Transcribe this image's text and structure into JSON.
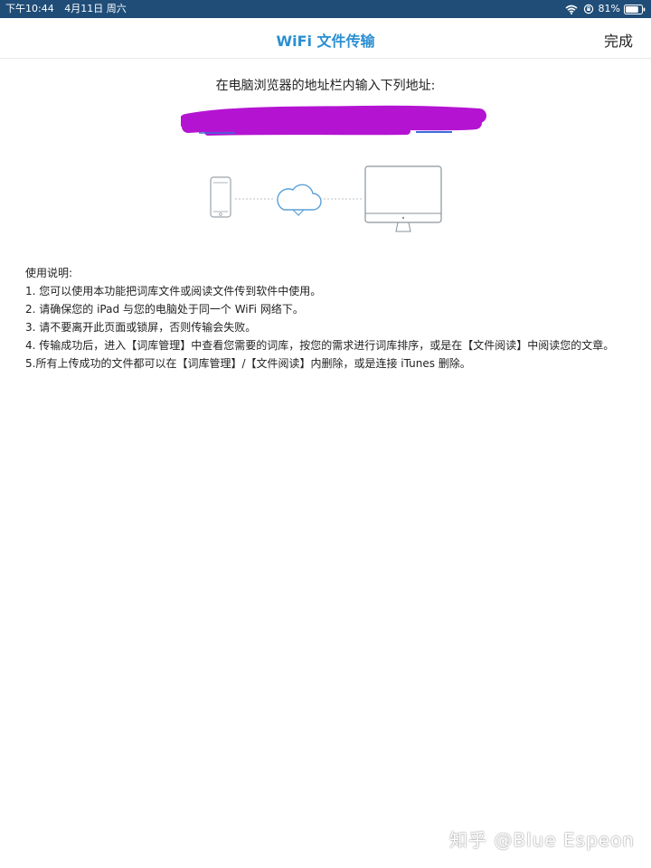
{
  "status_bar": {
    "time": "下午10:44",
    "date": "4月11日 周六",
    "battery_percent": "81%",
    "battery_level": 0.81,
    "icons": [
      "wifi-icon",
      "rotation-lock-icon",
      "battery-icon"
    ],
    "background_color": "#1f4d78"
  },
  "nav": {
    "title": "WiFi 文件传输",
    "done_label": "完成",
    "title_color": "#2a8fd1"
  },
  "instruction": "在电脑浏览器的地址栏内输入下列地址:",
  "address": {
    "redacted": true,
    "redaction_color": "#b414d2"
  },
  "illustration": {
    "icons": [
      "phone-icon",
      "cloud-icon",
      "monitor-icon"
    ]
  },
  "usage": {
    "heading": "使用说明:",
    "items": [
      "1. 您可以使用本功能把词库文件或阅读文件传到软件中使用。",
      "2. 请确保您的 iPad 与您的电脑处于同一个 WiFi 网络下。",
      "3. 请不要离开此页面或锁屏，否则传输会失败。",
      "4. 传输成功后，进入【词库管理】中查看您需要的词库，按您的需求进行词库排序，或是在【文件阅读】中阅读您的文章。",
      "5.所有上传成功的文件都可以在【词库管理】/【文件阅读】内删除，或是连接 iTunes 删除。"
    ]
  },
  "watermark": "知乎 @Blue Espeon"
}
